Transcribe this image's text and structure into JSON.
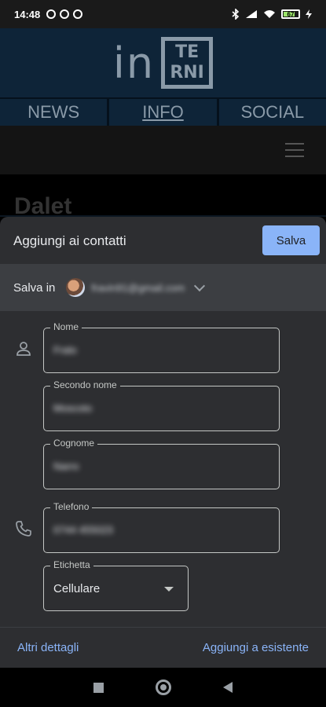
{
  "status_bar": {
    "time": "14:48",
    "battery": "67"
  },
  "site": {
    "logo_prefix": "in",
    "logo_box_line1": "TE",
    "logo_box_line2": "RNI",
    "nav": [
      "NEWS",
      "INFO",
      "SOCIAL"
    ],
    "peek_text": "Dalet"
  },
  "sheet": {
    "title": "Aggiungi ai contatti",
    "save_label": "Salva",
    "save_in_label": "Salva in",
    "account_email": "fravin91@gmail.com",
    "fields": {
      "nome": {
        "label": "Nome",
        "value": "Fralo"
      },
      "secondo_nome": {
        "label": "Secondo nome",
        "value": "Moscoto"
      },
      "cognome": {
        "label": "Cognome",
        "value": "Narro"
      },
      "telefono": {
        "label": "Telefono",
        "value": "0744 455023"
      },
      "etichetta": {
        "label": "Etichetta",
        "value": "Cellulare"
      }
    },
    "footer": {
      "more_details": "Altri dettagli",
      "add_existing": "Aggiungi a esistente"
    }
  },
  "colors": {
    "accent": "#8ab4f8",
    "sheet_bg": "#2d2e31",
    "save_in_bg": "#3c3e42"
  },
  "icons": [
    "person-icon",
    "phone-icon",
    "chevron-down-icon",
    "dropdown-arrow-icon",
    "hamburger-menu-icon"
  ]
}
